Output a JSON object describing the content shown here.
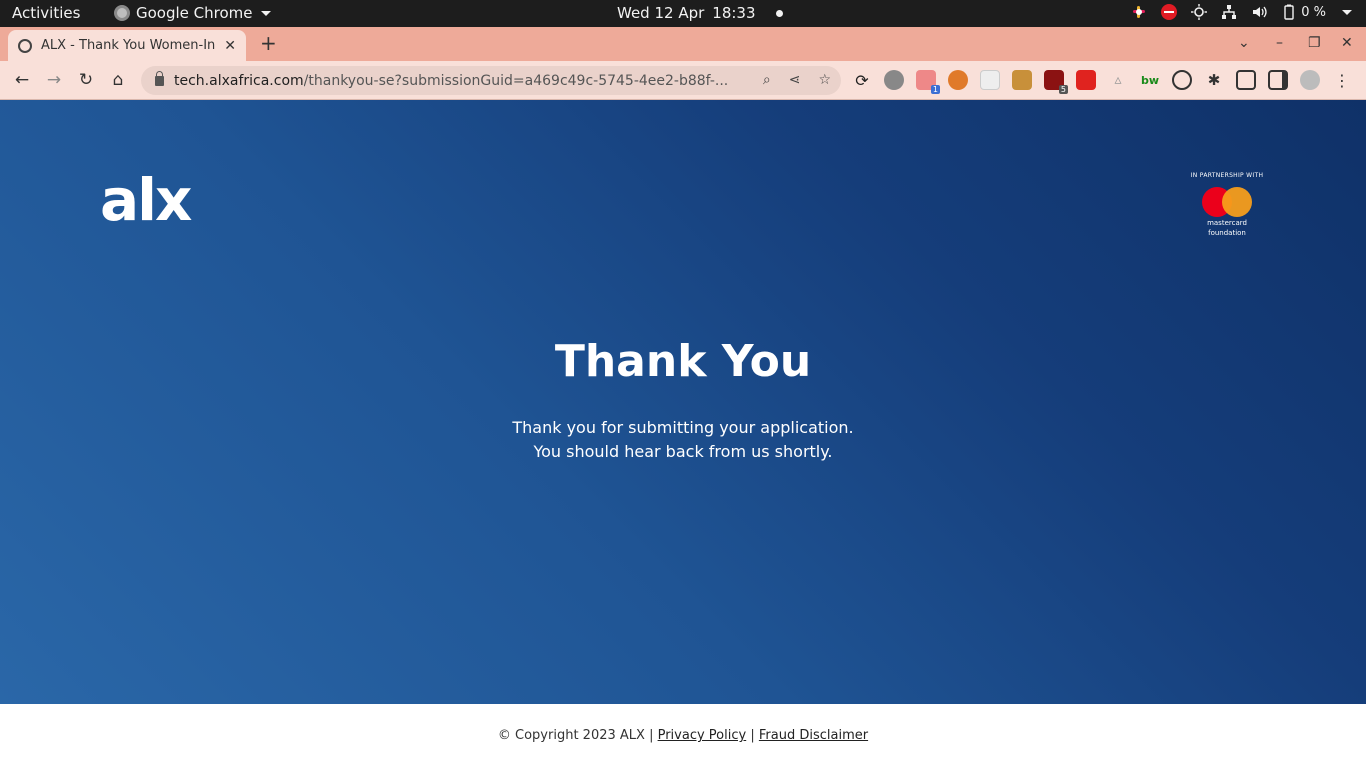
{
  "system_bar": {
    "activities": "Activities",
    "app_name": "Google Chrome",
    "date": "Wed 12 Apr",
    "time": "18:33",
    "battery": "0 %"
  },
  "browser": {
    "tab_title": "ALX - Thank You Women-In",
    "url_host": "tech.alxafrica.com",
    "url_path": "/thankyou-se?submissionGuid=a469c49c-5745-4ee2-b88f-...",
    "extension_badges": [
      "1",
      "5"
    ],
    "extension_labels": [
      "bw"
    ]
  },
  "page": {
    "logo": "alx",
    "partner_caption": "IN PARTNERSHIP WITH",
    "partner_brand_line1": "mastercard",
    "partner_brand_line2": "foundation",
    "heading": "Thank You",
    "message_line1": "Thank you for submitting your application.",
    "message_line2": "You should hear back from us shortly."
  },
  "footer": {
    "copyright": "© Copyright 2023 ALX |",
    "privacy": "Privacy Policy",
    "separator": "|",
    "fraud": "Fraud Disclaimer"
  },
  "colors": {
    "tab_strip": "#eeaa99",
    "page_gradient_start": "#2a67a8",
    "page_gradient_end": "#0f3168",
    "mastercard_red": "#eb001b",
    "mastercard_yellow": "#f79e1b"
  }
}
